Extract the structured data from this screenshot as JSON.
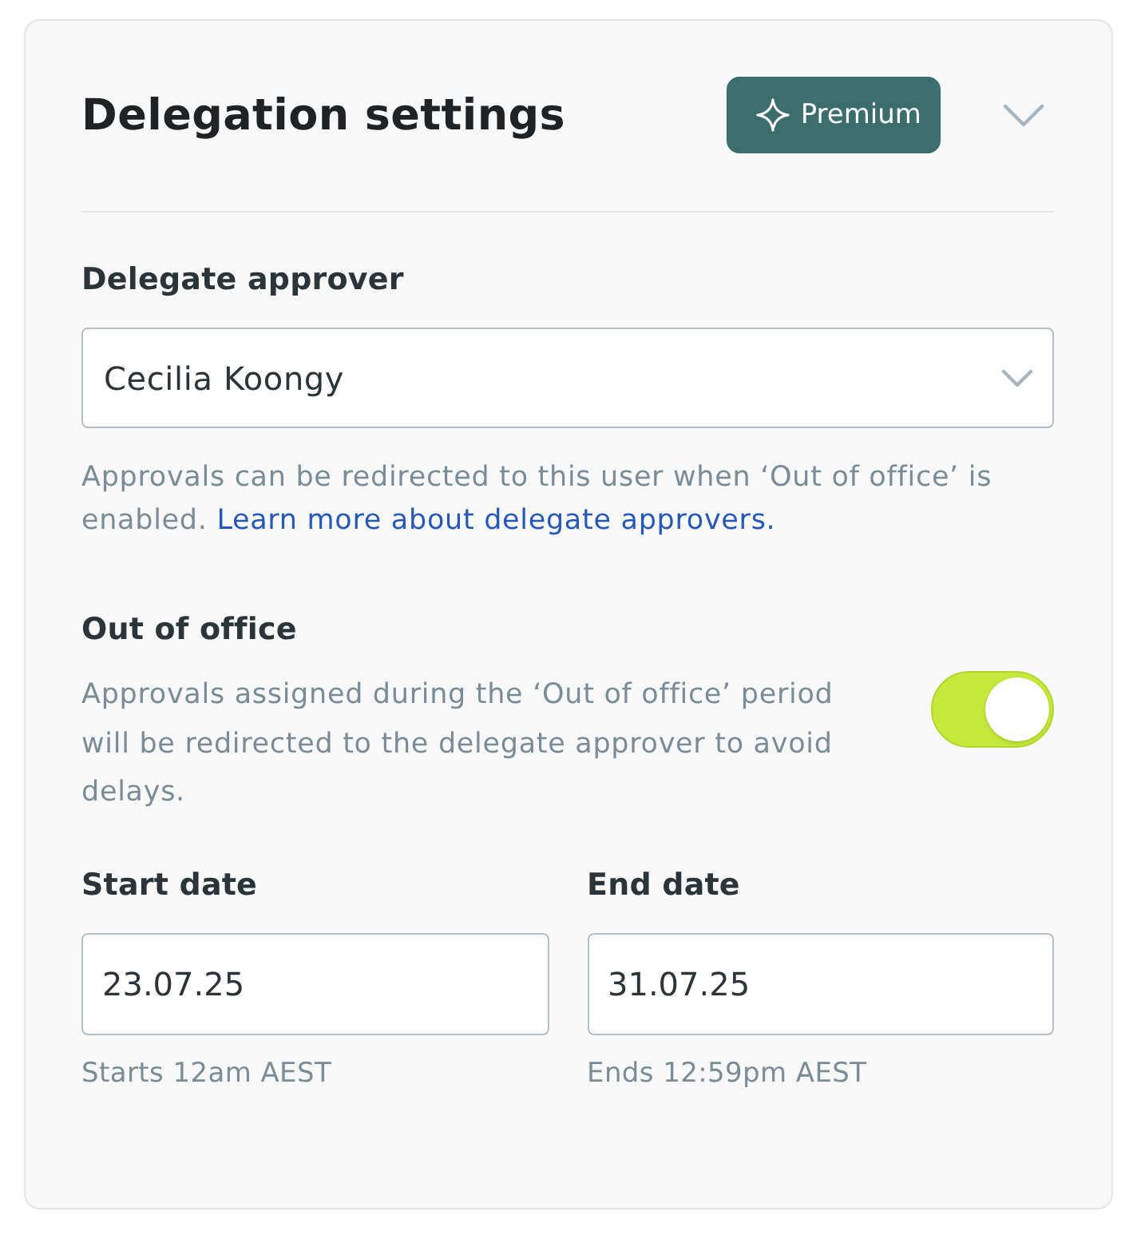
{
  "header": {
    "title": "Delegation settings",
    "badge": {
      "label": "Premium"
    }
  },
  "delegate_approver": {
    "label": "Delegate approver",
    "value": "Cecilia Koongy",
    "help": "Approvals can be redirected to this user when ‘Out of office’ is enabled.",
    "link": "Learn more about delegate approvers."
  },
  "out_of_office": {
    "label": "Out of office",
    "description": "Approvals assigned during the ‘Out of office’ period will be redirected to the delegate approver to avoid delays.",
    "on": true
  },
  "dates": [
    {
      "label": "Start date",
      "value": "23.07.25",
      "hint": "Starts 12am AEST"
    },
    {
      "label": "End date",
      "value": "31.07.25",
      "hint": "Ends 12:59pm AEST"
    }
  ]
}
